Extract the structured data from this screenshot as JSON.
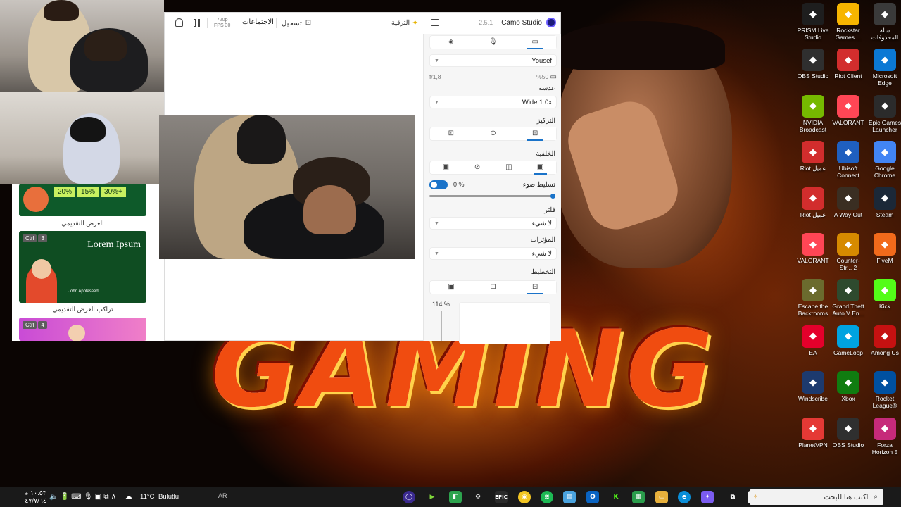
{
  "colors": {
    "accent": "#1a73c9",
    "brand": "#1b1b7a",
    "taskbar": "#1a1a1a",
    "fire": "#f04c10"
  },
  "wallpaper": {
    "logo_text": "GAMING"
  },
  "desktop": {
    "icons": [
      {
        "label": "سلة المحذوفات",
        "icon": "recycle-bin-icon"
      },
      {
        "label": "Rockstar Games ...",
        "icon": "rockstar-icon"
      },
      {
        "label": "PRISM Live Studio",
        "icon": "prism-icon"
      },
      {
        "label": "Microsoft Edge",
        "icon": "edge-icon"
      },
      {
        "label": "Riot Client",
        "icon": "riot-icon"
      },
      {
        "label": "OBS Studio",
        "icon": "obs-icon"
      },
      {
        "label": "Epic Games Launcher",
        "icon": "epic-icon"
      },
      {
        "label": "VALORANT",
        "icon": "valorant-icon"
      },
      {
        "label": "NVIDIA Broadcast",
        "icon": "nvidia-icon"
      },
      {
        "label": "Google Chrome",
        "icon": "chrome-icon"
      },
      {
        "label": "Ubisoft Connect",
        "icon": "ubisoft-icon"
      },
      {
        "label": "Riot عميل",
        "icon": "riot-icon"
      },
      {
        "label": "Steam",
        "icon": "steam-icon"
      },
      {
        "label": "A Way Out",
        "icon": "awayout-icon"
      },
      {
        "label": "Riot عميل",
        "icon": "riot-icon"
      },
      {
        "label": "FiveM",
        "icon": "fivem-icon"
      },
      {
        "label": "Counter-Str... 2",
        "icon": "cs2-icon"
      },
      {
        "label": "VALORANT",
        "icon": "valorant-icon"
      },
      {
        "label": "Kick",
        "icon": "kick-icon"
      },
      {
        "label": "Grand Theft Auto V En...",
        "icon": "gta-icon"
      },
      {
        "label": "Escape the Backrooms",
        "icon": "backrooms-icon"
      },
      {
        "label": "Among Us",
        "icon": "amongus-icon"
      },
      {
        "label": "GameLoop",
        "icon": "gameloop-icon"
      },
      {
        "label": "EA",
        "icon": "ea-icon"
      },
      {
        "label": "Rocket League®",
        "icon": "rocketleague-icon"
      },
      {
        "label": "Xbox",
        "icon": "xbox-icon"
      },
      {
        "label": "Windscribe",
        "icon": "windscribe-icon"
      },
      {
        "label": "Forza Horizon 5",
        "icon": "forza-icon"
      },
      {
        "label": "OBS Studio",
        "icon": "obs-icon"
      },
      {
        "label": "PlanetVPN",
        "icon": "planetvpn-icon"
      }
    ]
  },
  "presets": {
    "card1": {
      "stats": [
        "20%",
        "15%",
        "30%+"
      ],
      "label": "الغرض التقديمي"
    },
    "card2": {
      "ctrl": "Ctrl",
      "num": "3",
      "title": "Lorem Ipsum",
      "name": "John Appleseed",
      "label": "تراكب العرض التقديمي"
    },
    "card3": {
      "ctrl": "Ctrl",
      "num": "4"
    }
  },
  "camo": {
    "app_name": "Camo Studio",
    "version": "2.5.1",
    "upgrade_label": "الترقية",
    "record_label": "تسجيل",
    "meetings_label": "الاجتماعات",
    "resolution": "720p",
    "fps": "FPS 30",
    "panel": {
      "tabs": [
        "video-icon",
        "mic-icon",
        "layers-icon"
      ],
      "device": "Yousef",
      "battery": "%50",
      "aperture": "f/1,8",
      "lens_title": "عدسة",
      "lens_value": "Wide 1.0x",
      "focus_title": "التركيز",
      "background_title": "الخلفية",
      "lighting_title": "تسليط ضوء",
      "lighting_value": "0 %",
      "filter_title": "فلتر",
      "filter_value": "لا شيء",
      "effects_title": "المؤثرات",
      "effects_value": "لا شيء",
      "layout_title": "التخطيط",
      "zoom": "114 %"
    }
  },
  "taskbar": {
    "search_placeholder": "اكتب هنا للبحث",
    "weather_temp": "11°C",
    "weather_text": "Bulutlu",
    "lang": "AR",
    "time": "١٠:٥٣ م",
    "date": "٤٧/٧/٦٤"
  }
}
